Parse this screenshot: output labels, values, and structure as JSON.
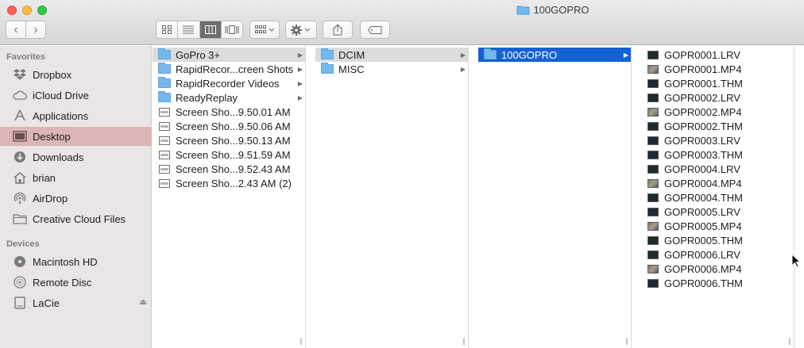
{
  "window": {
    "title": "100GOPRO"
  },
  "toolbar": {
    "back_icon": "chevron-left-icon",
    "forward_icon": "chevron-right-icon",
    "view_modes": [
      "icon-view",
      "list-view",
      "column-view",
      "coverflow-view"
    ],
    "active_view": "column-view",
    "arrange_icon": "arrange-grid-icon",
    "action_icon": "gear-icon",
    "share_icon": "share-icon",
    "tag_icon": "tag-icon"
  },
  "sidebar": {
    "favorites_header": "Favorites",
    "favorites": [
      {
        "label": "Dropbox",
        "icon": "dropbox-icon"
      },
      {
        "label": "iCloud Drive",
        "icon": "cloud-icon"
      },
      {
        "label": "Applications",
        "icon": "applications-icon"
      },
      {
        "label": "Desktop",
        "icon": "desktop-icon",
        "selected": true
      },
      {
        "label": "Downloads",
        "icon": "downloads-icon"
      },
      {
        "label": "brian",
        "icon": "home-icon"
      },
      {
        "label": "AirDrop",
        "icon": "airdrop-icon"
      },
      {
        "label": "Creative Cloud Files",
        "icon": "folder-icon"
      }
    ],
    "devices_header": "Devices",
    "devices": [
      {
        "label": "Macintosh HD",
        "icon": "hard-drive-icon"
      },
      {
        "label": "Remote Disc",
        "icon": "disc-icon"
      },
      {
        "label": "LaCie",
        "icon": "external-drive-icon",
        "eject": true
      }
    ]
  },
  "columns": {
    "col1": [
      {
        "label": "GoPro 3+",
        "type": "folder"
      },
      {
        "label": "RapidRecor...creen Shots",
        "type": "folder"
      },
      {
        "label": "RapidRecorder Videos",
        "type": "folder"
      },
      {
        "label": "ReadyReplay",
        "type": "folder"
      },
      {
        "label": "Screen Sho...9.50.01 AM",
        "type": "screenshot"
      },
      {
        "label": "Screen Sho...9.50.06 AM",
        "type": "screenshot"
      },
      {
        "label": "Screen Sho...9.50.13 AM",
        "type": "screenshot"
      },
      {
        "label": "Screen Sho...9.51.59 AM",
        "type": "screenshot"
      },
      {
        "label": "Screen Sho...9.52.43 AM",
        "type": "screenshot"
      },
      {
        "label": "Screen Sho...2.43 AM (2)",
        "type": "screenshot"
      }
    ],
    "col2": [
      {
        "label": "DCIM",
        "type": "folder"
      },
      {
        "label": "MISC",
        "type": "folder"
      }
    ],
    "col3": [
      {
        "label": "100GOPRO",
        "type": "folder"
      }
    ],
    "col4": [
      {
        "label": "GOPR0001.LRV",
        "type": "thm"
      },
      {
        "label": "GOPR0001.MP4",
        "type": "mp4"
      },
      {
        "label": "GOPR0001.THM",
        "type": "thm"
      },
      {
        "label": "GOPR0002.LRV",
        "type": "thm"
      },
      {
        "label": "GOPR0002.MP4",
        "type": "mp4"
      },
      {
        "label": "GOPR0002.THM",
        "type": "thm"
      },
      {
        "label": "GOPR0003.LRV",
        "type": "thm"
      },
      {
        "label": "GOPR0003.THM",
        "type": "thm"
      },
      {
        "label": "GOPR0004.LRV",
        "type": "thm"
      },
      {
        "label": "GOPR0004.MP4",
        "type": "mp4"
      },
      {
        "label": "GOPR0004.THM",
        "type": "thm"
      },
      {
        "label": "GOPR0005.LRV",
        "type": "thm"
      },
      {
        "label": "GOPR0005.MP4",
        "type": "mp4"
      },
      {
        "label": "GOPR0005.THM",
        "type": "thm"
      },
      {
        "label": "GOPR0006.LRV",
        "type": "thm"
      },
      {
        "label": "GOPR0006.MP4",
        "type": "mp4"
      },
      {
        "label": "GOPR0006.THM",
        "type": "thm"
      }
    ]
  },
  "colors": {
    "selection_active": "#1462d4",
    "selection_inactive": "#dcdcdc",
    "sidebar_selected": "#dcb6b4",
    "folder": "#74b8ed"
  }
}
